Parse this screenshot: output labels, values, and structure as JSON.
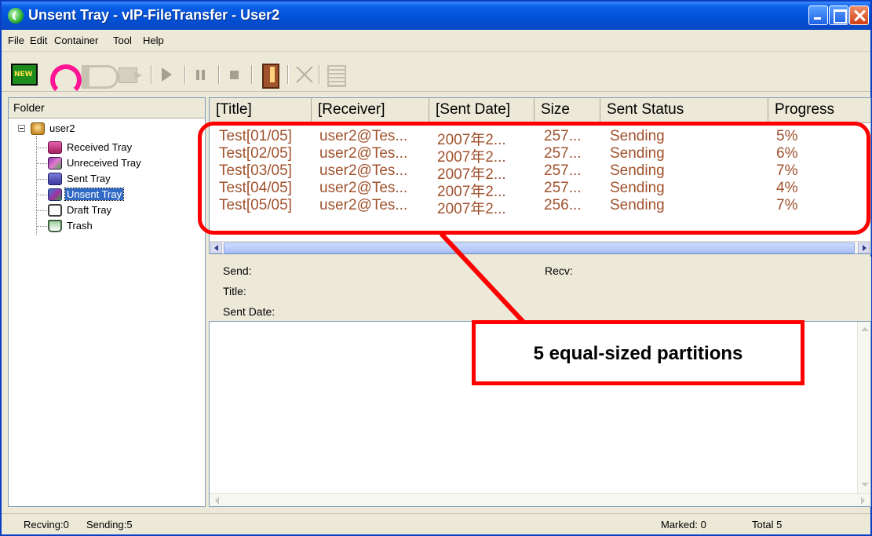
{
  "window": {
    "title": "Unsent Tray - vIP-FileTransfer - User2"
  },
  "menu": [
    "File",
    "Edit",
    "Container",
    "Tool",
    "Help"
  ],
  "toolbar": {
    "buttons": [
      "new-icon",
      "refresh-icon",
      "resend-icon",
      "move-icon",
      "play-icon",
      "pause-icon",
      "stop-icon",
      "door-icon",
      "delete-icon",
      "properties-icon"
    ]
  },
  "folders": {
    "header": "Folder",
    "root": "user2",
    "items": [
      {
        "label": "Received Tray",
        "icon": "received-tray-icon"
      },
      {
        "label": "Unreceived Tray",
        "icon": "unreceived-tray-icon"
      },
      {
        "label": "Sent Tray",
        "icon": "sent-tray-icon"
      },
      {
        "label": "Unsent Tray",
        "icon": "unsent-tray-icon",
        "selected": true
      },
      {
        "label": "Draft Tray",
        "icon": "draft-tray-icon"
      },
      {
        "label": "Trash",
        "icon": "trash-icon"
      }
    ]
  },
  "list": {
    "columns": [
      "[Title]",
      "[Receiver]",
      "[Sent Date]",
      "Size",
      "Sent Status",
      "Progress"
    ],
    "rows": [
      [
        "Test[01/05]",
        "user2@Tes...",
        "2007年2...",
        "257...",
        "Sending",
        "5%"
      ],
      [
        "Test[02/05]",
        "user2@Tes...",
        "2007年2...",
        "257...",
        "Sending",
        "6%"
      ],
      [
        "Test[03/05]",
        "user2@Tes...",
        "2007年2...",
        "257...",
        "Sending",
        "7%"
      ],
      [
        "Test[04/05]",
        "user2@Tes...",
        "2007年2...",
        "257...",
        "Sending",
        "4%"
      ],
      [
        "Test[05/05]",
        "user2@Tes...",
        "2007年2...",
        "256...",
        "Sending",
        "7%"
      ]
    ],
    "row_color": "#a0522d"
  },
  "details": {
    "send_label": "Send:",
    "recv_label": "Recv:",
    "title_label": "Title:",
    "sent_date_label": "Sent Date:"
  },
  "status": {
    "receiving": "Recving:0",
    "sending": "Sending:5",
    "marked": "Marked:  0",
    "total": "Total   5"
  },
  "annotation": {
    "callout_text": "5 equal-sized partitions",
    "color": "#ff0000"
  }
}
